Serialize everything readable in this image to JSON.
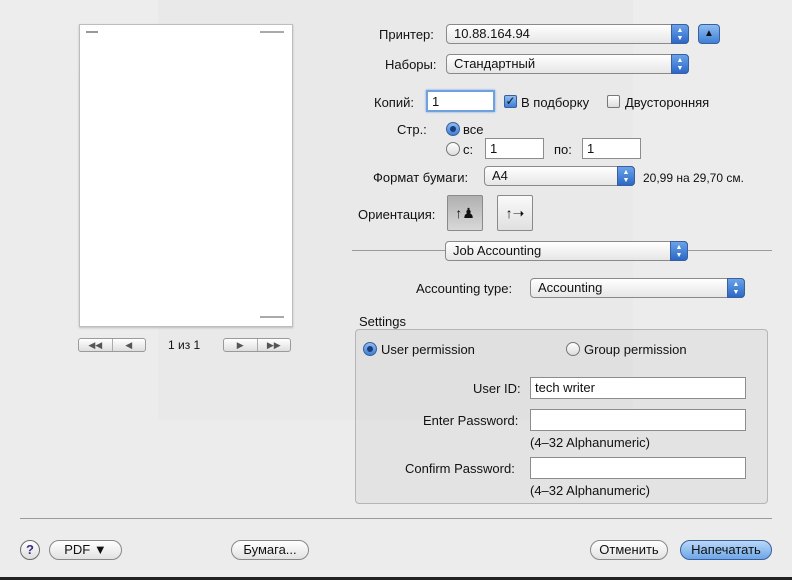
{
  "preview": {
    "page_indicator": "1 из 1",
    "first_label": "◀◀",
    "prev_label": "◀",
    "next_label": "▶",
    "last_label": "▶▶"
  },
  "printer": {
    "label": "Принтер:",
    "value": "10.88.164.94",
    "collapse_icon": "triangle-up-icon"
  },
  "presets": {
    "label": "Наборы:",
    "value": "Стандартный"
  },
  "copies": {
    "label": "Копий:",
    "value": "1",
    "collated_label": "В подборку",
    "collated": true,
    "duplex_label": "Двусторонняя",
    "duplex": false
  },
  "pages": {
    "label": "Стр.:",
    "all_label": "все",
    "from_label": "с:",
    "from_value": "1",
    "to_label": "по:",
    "to_value": "1",
    "selected": "all"
  },
  "paper": {
    "label": "Формат бумаги:",
    "value": "A4",
    "size_text": "20,99 на 29,70 см."
  },
  "orientation": {
    "label": "Ориентация:",
    "selected": "portrait"
  },
  "panel": {
    "value": "Job Accounting"
  },
  "accounting": {
    "label": "Accounting type:",
    "value": "Accounting"
  },
  "settings": {
    "title": "Settings",
    "user_permission_label": "User permission",
    "group_permission_label": "Group permission",
    "selected": "user",
    "user_id_label": "User ID:",
    "user_id_value": "tech writer",
    "enter_password_label": "Enter Password:",
    "enter_password_hint": "(4–32 Alphanumeric)",
    "confirm_password_label": "Confirm Password:",
    "confirm_password_hint": "(4–32 Alphanumeric)"
  },
  "footer": {
    "help_label": "?",
    "pdf_label": "PDF ▼",
    "paper_label": "Бумага...",
    "cancel_label": "Отменить",
    "print_label": "Напечатать"
  },
  "colors": {
    "accent": "#3f7fd6",
    "primary_button": "#6ea6e8"
  }
}
